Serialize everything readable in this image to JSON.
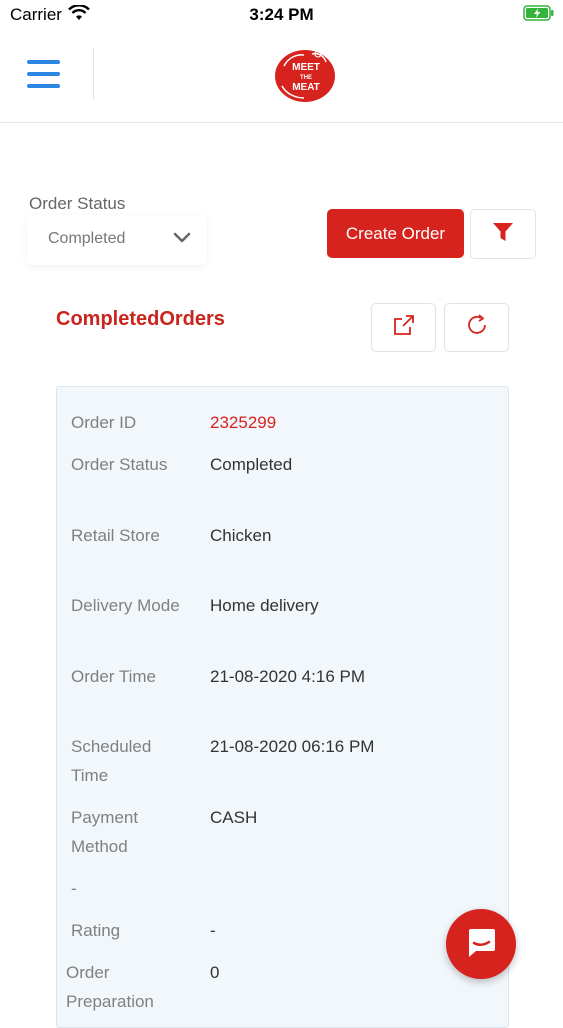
{
  "status_bar": {
    "carrier": "Carrier",
    "time": "3:24 PM"
  },
  "header": {
    "logo_text_1": "MEET",
    "logo_text_2": "THE",
    "logo_text_3": "MEAT"
  },
  "filters": {
    "status_label": "Order Status",
    "status_value": "Completed",
    "create_order_label": "Create Order"
  },
  "section": {
    "title": "CompletedOrders"
  },
  "order": {
    "rows": [
      {
        "label": "Order ID",
        "value": "2325299"
      },
      {
        "label": "Order Status",
        "value": "Completed"
      },
      {
        "label": "Retail Store",
        "value": "Chicken"
      },
      {
        "label": "Delivery Mode",
        "value": "Home delivery"
      },
      {
        "label": "Order Time",
        "value": "21-08-2020 4:16 PM"
      },
      {
        "label": "Scheduled Time",
        "value": "21-08-2020 06:16 PM"
      },
      {
        "label": "Payment Method",
        "value": "CASH"
      },
      {
        "label": "-",
        "value": ""
      },
      {
        "label": "Rating",
        "value": "-"
      },
      {
        "label": "Order Preparation",
        "value": "0"
      }
    ]
  },
  "colors": {
    "brand_red": "#d7231d",
    "menu_blue": "#2c86e6",
    "card_bg": "#f2f7fb"
  }
}
